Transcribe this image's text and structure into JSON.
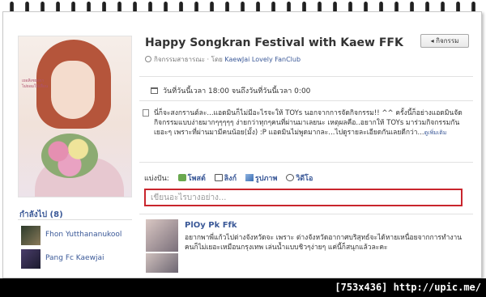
{
  "event": {
    "title": "Happy Songkran Festival with Kaew FFK",
    "privacy": "กิจกรรมสาธารณะ",
    "by_label": "โดย",
    "host": "KaewJai Lovely FanClub",
    "time": "วันที่วันนี้เวลา 18:00 จนถึงวันที่วันนี้เวลา 0:00",
    "description": "นี่ก็จะสงกรานต์ละ...แอดมินก็ไม่มีอะไรจะให้ TOYs นอกจากการจัดกิจกรรม!! ^^ ครั้งนี้ก็อย่างแอดมินจัดกิจกรรมแบบง่ายมากๆๆๆๆๆ ง่ายกว่าทุกๆคนที่ผ่านมาเลยนะ เหตุผลคือ..อยากให้ TOYs มาร่วมกิจกรรมกันเยอะๆ เพราะที่ผ่านมามีคนน้อย(มั้ง) :P แอดมินไม่พูดมากละ...ไปดูรายละเอียดกันเลยดีกว่า...",
    "see_more": "ดูเพิ่มเติม"
  },
  "toolbar": {
    "back_label": "◂ กิจกรรม"
  },
  "profile_photo": {
    "caption_lines": [
      "เยอลิเซยอรา",
      "ไม่ยอมให้เพื่อน"
    ]
  },
  "attending": {
    "title": "กำลังไป (8)",
    "people": [
      {
        "name": "Fhon Yutthananukool"
      },
      {
        "name": "Pang Fc Kaewjai"
      }
    ]
  },
  "share": {
    "label": "แบ่งปัน:",
    "options": [
      "โพสต์",
      "ลิงก์",
      "รูปภาพ",
      "วิดีโอ"
    ]
  },
  "compose": {
    "placeholder": "เขียนอะไรบางอย่าง..."
  },
  "post": {
    "author": "PlOy Pk Ffk",
    "text": "อยากพาพี่แก้วไปต่างจังหวัดจะ เพราะ ต่างจังหวัดอากาศบริสุทธ์จะได้หายเหนื่อยจากการทำงาน คนก็ไม่เยอะเหมือนกรุงเทพ เล่นน้ำแบบชิวๆง่ายๆ แค่นี้ก็สนุกแล้วละคะ"
  },
  "watermark": "[753x436] http://upic.me/",
  "colors": {
    "link": "#3b5998",
    "compose_border": "#c9252d",
    "frame": "#000000"
  }
}
